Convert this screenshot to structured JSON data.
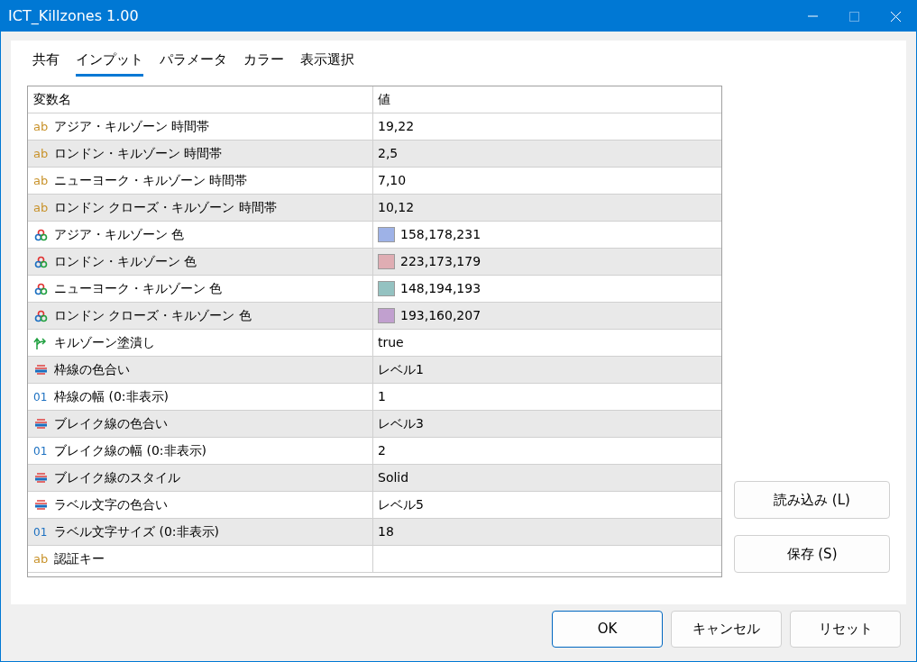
{
  "window": {
    "title": "ICT_Killzones 1.00"
  },
  "tabs": [
    {
      "label": "共有",
      "selected": false
    },
    {
      "label": "インプット",
      "selected": true
    },
    {
      "label": "パラメータ",
      "selected": false
    },
    {
      "label": "カラー",
      "selected": false
    },
    {
      "label": "表示選択",
      "selected": false
    }
  ],
  "table": {
    "columns": [
      "変数名",
      "値"
    ],
    "rows": [
      {
        "kind": "text",
        "type_icon": "ab",
        "name": "アジア・キルゾーン 時間帯",
        "value": "19,22"
      },
      {
        "kind": "text",
        "type_icon": "ab",
        "name": "ロンドン・キルゾーン 時間帯",
        "value": "2,5"
      },
      {
        "kind": "text",
        "type_icon": "ab",
        "name": "ニューヨーク・キルゾーン 時間帯",
        "value": "7,10"
      },
      {
        "kind": "text",
        "type_icon": "ab",
        "name": "ロンドン クローズ・キルゾーン 時間帯",
        "value": "10,12"
      },
      {
        "kind": "color",
        "name": "アジア・キルゾーン 色",
        "value": "158,178,231",
        "color": "#9eb2e7"
      },
      {
        "kind": "color",
        "name": "ロンドン・キルゾーン 色",
        "value": "223,173,179",
        "color": "#dfadb3"
      },
      {
        "kind": "color",
        "name": "ニューヨーク・キルゾーン 色",
        "value": "148,194,193",
        "color": "#94c2c1"
      },
      {
        "kind": "color",
        "name": "ロンドン クローズ・キルゾーン 色",
        "value": "193,160,207",
        "color": "#c1a0cf"
      },
      {
        "kind": "bool",
        "name": "キルゾーン塗潰し",
        "value": "true"
      },
      {
        "kind": "enum",
        "name": "枠線の色合い",
        "value": "レベル1"
      },
      {
        "kind": "int",
        "type_icon": "01",
        "name": "枠線の幅 (0:非表示)",
        "value": "1"
      },
      {
        "kind": "enum",
        "name": "ブレイク線の色合い",
        "value": "レベル3"
      },
      {
        "kind": "int",
        "type_icon": "01",
        "name": "ブレイク線の幅 (0:非表示)",
        "value": "2"
      },
      {
        "kind": "enum",
        "name": "ブレイク線のスタイル",
        "value": "Solid"
      },
      {
        "kind": "enum",
        "name": "ラベル文字の色合い",
        "value": "レベル5"
      },
      {
        "kind": "int",
        "type_icon": "01",
        "name": "ラベル文字サイズ (0:非表示)",
        "value": "18"
      },
      {
        "kind": "text",
        "type_icon": "ab",
        "name": "認証キー"
      }
    ]
  },
  "side_buttons": [
    "読み込み (L)",
    "保存 (S)"
  ],
  "footer_buttons": [
    {
      "label": "OK",
      "default": true
    },
    {
      "label": "キャンセル",
      "default": false
    },
    {
      "label": "リセット",
      "default": false
    }
  ]
}
